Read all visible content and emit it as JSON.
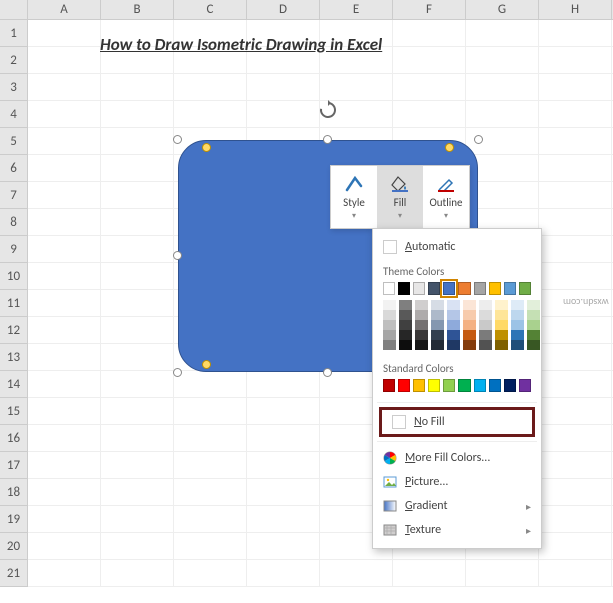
{
  "cols": [
    "A",
    "B",
    "C",
    "D",
    "E",
    "F",
    "G",
    "H"
  ],
  "rows": [
    "1",
    "2",
    "3",
    "4",
    "5",
    "6",
    "7",
    "8",
    "9",
    "10",
    "11",
    "12",
    "13",
    "14",
    "15",
    "16",
    "17",
    "18",
    "19",
    "20",
    "21"
  ],
  "title": "How to Draw Isometric Drawing in Excel",
  "mini": {
    "style": "Style",
    "fill": "Fill",
    "outline": "Outline"
  },
  "dd": {
    "automatic": "Automatic",
    "theme": "Theme Colors",
    "standard": "Standard Colors",
    "nofill": "No Fill",
    "more": "More Fill Colors...",
    "picture": "Picture...",
    "gradient": "Gradient",
    "texture": "Texture"
  },
  "theme_row": [
    "#ffffff",
    "#000000",
    "#e7e6e6",
    "#44546a",
    "#4472c4",
    "#ed7d31",
    "#a5a5a5",
    "#ffc000",
    "#5b9bd5",
    "#70ad47"
  ],
  "tints": [
    [
      "#f2f2f2",
      "#d9d9d9",
      "#bfbfbf",
      "#a6a6a6",
      "#808080"
    ],
    [
      "#7f7f7f",
      "#595959",
      "#404040",
      "#262626",
      "#0d0d0d"
    ],
    [
      "#d0cece",
      "#aeabab",
      "#757171",
      "#3a3838",
      "#161616"
    ],
    [
      "#d6dce5",
      "#adb9ca",
      "#8497b0",
      "#333f50",
      "#222a35"
    ],
    [
      "#d9e2f3",
      "#b4c6e7",
      "#8eaadb",
      "#2f5496",
      "#1f3864"
    ],
    [
      "#fbe5d6",
      "#f7cbac",
      "#f4b183",
      "#c55a11",
      "#843c0c"
    ],
    [
      "#ededed",
      "#dbdbdb",
      "#c9c9c9",
      "#7b7b7b",
      "#525252"
    ],
    [
      "#fff2cc",
      "#fee599",
      "#ffd966",
      "#bf9000",
      "#7f6000"
    ],
    [
      "#deebf7",
      "#bdd7ee",
      "#9cc3e6",
      "#2e75b6",
      "#1f4e79"
    ],
    [
      "#e2efda",
      "#c5e0b4",
      "#a9d18e",
      "#548235",
      "#385723"
    ]
  ],
  "standard_colors": [
    "#c00000",
    "#ff0000",
    "#ffc000",
    "#ffff00",
    "#92d050",
    "#00b050",
    "#00b0f0",
    "#0070c0",
    "#002060",
    "#7030a0"
  ],
  "watermark": "wxsdn.com"
}
